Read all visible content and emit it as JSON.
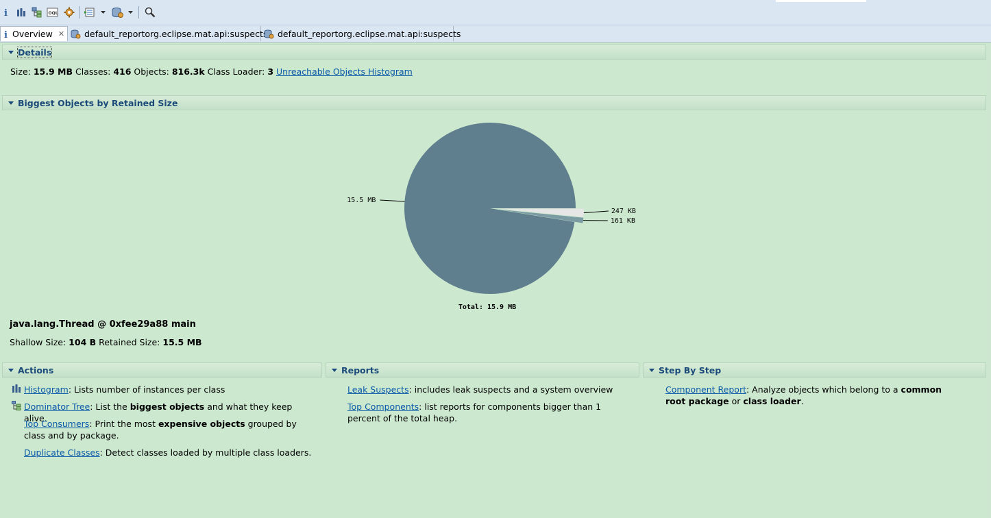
{
  "tabs": [
    {
      "label": "Overview",
      "active": true,
      "icon": "info-icon"
    },
    {
      "label": "default_report",
      "sublabel": "org.eclipse.mat.api:suspects",
      "icon": "report-icon"
    },
    {
      "label": "default_report",
      "sublabel": "org.eclipse.mat.api:suspects",
      "icon": "report-icon"
    }
  ],
  "toolbar": {
    "icons": [
      "info-icon",
      "histogram-icon",
      "dominator-tree-icon",
      "oql-icon",
      "settings-gear-icon",
      "query-browser-icon",
      "dropdown-arrow-icon",
      "heap-dump-icon",
      "dropdown-arrow-icon",
      "search-icon"
    ]
  },
  "details": {
    "title": "Details",
    "size_label": "Size:",
    "size_value": "15.9 MB",
    "classes_label": "Classes:",
    "classes_value": "416",
    "objects_label": "Objects:",
    "objects_value": "816.3k",
    "classloader_label": "Class Loader:",
    "classloader_value": "3",
    "unreachable_link": "Unreachable Objects Histogram"
  },
  "biggest": {
    "title": "Biggest Objects by Retained Size",
    "object_name": "java.lang.Thread @ 0xfee29a88 main",
    "shallow_label": "Shallow Size:",
    "shallow_value": "104 B",
    "retained_label": "Retained Size:",
    "retained_value": "15.5 MB"
  },
  "chart_data": {
    "type": "pie",
    "total_label": "Total: 15.9 MB",
    "slices": [
      {
        "label": "15.5 MB",
        "value": 15.5,
        "color": "#607f8e"
      },
      {
        "label": "247 KB",
        "value": 0.247,
        "color": "#e6e6e6"
      },
      {
        "label": "161 KB",
        "value": 0.161,
        "color": "#7c9ca4"
      }
    ]
  },
  "actions": {
    "title": "Actions",
    "items": [
      {
        "link": "Histogram",
        "pre": ": Lists number of instances per class",
        "bold": "",
        "post": "",
        "icon": "histogram-icon"
      },
      {
        "link": "Dominator Tree",
        "pre": ": List the ",
        "bold": "biggest objects",
        "post": " and what they keep alive.",
        "icon": "dominator-tree-icon"
      },
      {
        "link": "Top Consumers",
        "pre": ": Print the most ",
        "bold": "expensive objects",
        "post": " grouped by class and by package.",
        "icon": ""
      },
      {
        "link": "Duplicate Classes",
        "pre": ": Detect classes loaded by multiple class loaders.",
        "bold": "",
        "post": "",
        "icon": ""
      }
    ]
  },
  "reports": {
    "title": "Reports",
    "items": [
      {
        "link": "Leak Suspects",
        "pre": ": includes leak suspects and a system overview",
        "bold": "",
        "post": ""
      },
      {
        "link": "Top Components",
        "pre": ": list reports for components bigger than 1 percent of the total heap.",
        "bold": "",
        "post": ""
      }
    ]
  },
  "stepbystep": {
    "title": "Step By Step",
    "items": [
      {
        "link": "Component Report",
        "pre": ": Analyze objects which belong to a ",
        "bold": "common root package",
        "mid": " or ",
        "bold2": "class loader",
        "post": "."
      }
    ]
  },
  "colors": {
    "background": "#cce8cf",
    "section_title": "#1c4b7a",
    "link": "#0a5aa8"
  }
}
